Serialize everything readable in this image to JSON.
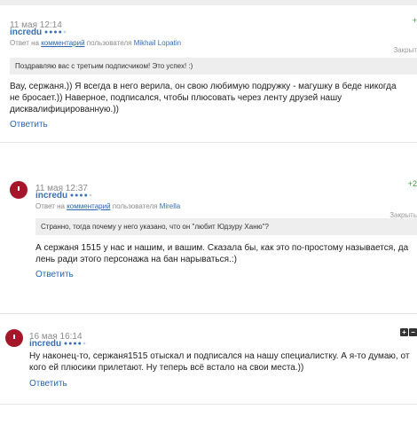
{
  "comments": [
    {
      "date": "11 мая 12:14",
      "author": "incredu",
      "rank_on": "●●●●",
      "rank_off": "●",
      "reply_prefix": "Ответ на",
      "reply_link": "комментарий",
      "reply_mid": "пользователя",
      "reply_user": "Mikhail Lopatin",
      "closed_label": "Закрыт",
      "score": "+",
      "quote": "Поздравляю вас с третьим подписчиком! Это успех! :)",
      "text": "Вау, сержаня.)) Я всегда в него верила, он свою любимую подружку - магушку в беде никогда не бросает.)) Наверное, подписался, чтобы плюсовать через ленту друзей нашу дисквалифицированную.))",
      "reply_label": "Ответить"
    },
    {
      "date": "11 мая 12:37",
      "author": "incredu",
      "rank_on": "●●●●",
      "rank_off": "●",
      "reply_prefix": "Ответ на",
      "reply_link": "комментарий",
      "reply_mid": "пользователя",
      "reply_user": "Mirella",
      "closed_label": "Закрыть",
      "score": "+2",
      "quote": "Странно, тогда почему у него указано, что он \"любит Юдзуру Ханю\"?",
      "text": "А сержаня 1515 у нас и нашим, и вашим. Сказала бы, как это по-простому называется, да лень ради этого персонажа на бан нарываться.:)",
      "reply_label": "Ответить"
    },
    {
      "date": "16 мая 16:14",
      "author": "incredu",
      "rank_on": "●●●●",
      "rank_off": "●",
      "text": "Ну наконец-то, сержаня1515 отыскал и подписался на нашу специалистку. А я-то думаю, от кого ей плюсики прилетают. Ну теперь всё встало на свои места.))",
      "reply_label": "Ответить"
    }
  ],
  "colors": {
    "link": "#2a66b1",
    "author": "#3a6fb5",
    "score": "#2e9a3e",
    "quote_bg": "#eeeeee",
    "avatar": "#a5162b"
  }
}
